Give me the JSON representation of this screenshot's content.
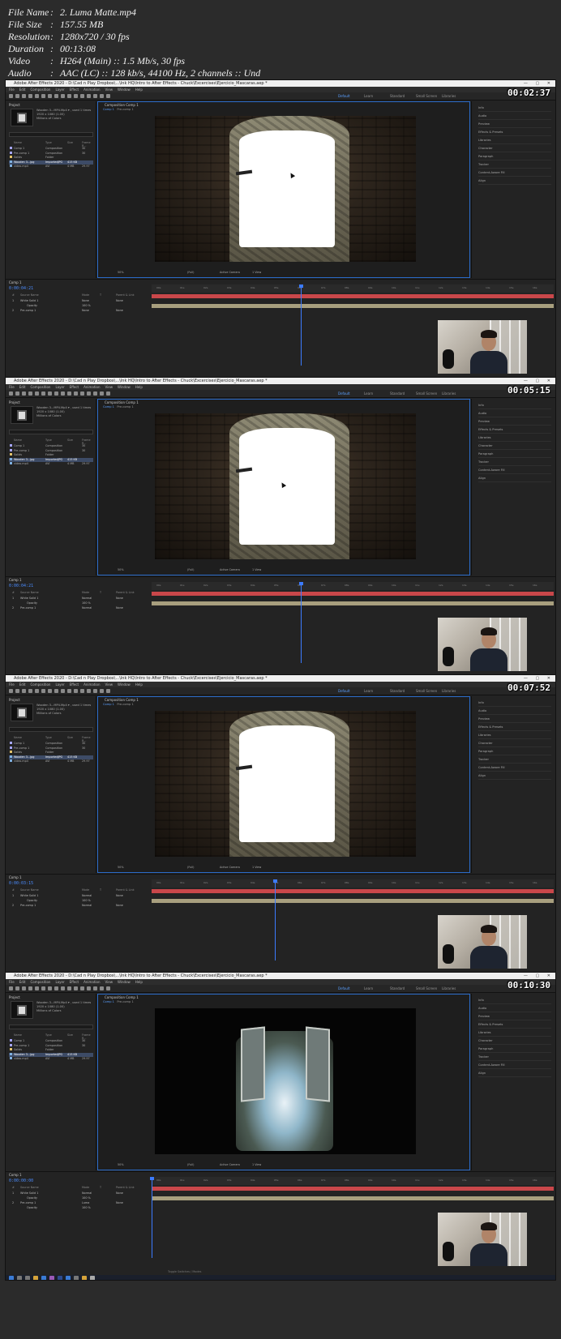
{
  "file_info": [
    {
      "key": "File Name",
      "value": "2. Luma Matte.mp4"
    },
    {
      "key": "File Size",
      "value": "157.55 MB"
    },
    {
      "key": "Resolution",
      "value": "1280x720 / 30 fps"
    },
    {
      "key": "Duration",
      "value": "00:13:08"
    },
    {
      "key": "Video",
      "value": "H264 (Main) :: 1.5 Mb/s, 30 fps"
    },
    {
      "key": "Audio",
      "value": "AAC (LC) :: 128 kb/s, 44100 Hz, 2 channels :: Und"
    }
  ],
  "separator": ":",
  "app": {
    "title": "Adobe After Effects 2020 - D:\\Cad n Play Dropbox\\...\\Ink HQ\\Intro to After Effects - Chuck\\Excercises\\Ejercicio_Mascaras.aep *",
    "window_controls": "— ▢ ✕",
    "menu": [
      "File",
      "Edit",
      "Composition",
      "Layer",
      "Effect",
      "Animation",
      "View",
      "Window",
      "Help"
    ],
    "workspaces": [
      "Default",
      "Learn",
      "Standard",
      "Small Screen",
      "Libraries"
    ],
    "project_label": "Project",
    "comp_tab": "Composition  Comp 1",
    "comp_breadcrumb": "Comp 1",
    "precomp_label": "Pre-comp 1",
    "project_info": [
      "Wooden 3...MP4.Mp4 ▾ , used 1 times",
      "1920 x 1080 (1.00)",
      "Millions of Colors"
    ],
    "project_columns": [
      "Name",
      "Type",
      "Size",
      "Frame R..."
    ],
    "project_items": [
      {
        "name": "Comp 1",
        "type": "Composition",
        "size": "",
        "rate": "30",
        "color": "#a6a6ff"
      },
      {
        "name": "Pre-comp 1",
        "type": "Composition",
        "size": "",
        "rate": "30",
        "color": "#a6a6ff"
      },
      {
        "name": "Solids",
        "type": "Folder",
        "size": "",
        "rate": "",
        "color": "#e3c36b"
      },
      {
        "name": "Wooden 3...jpg",
        "type": "ImportedJPG",
        "size": "415 KB",
        "rate": "",
        "color": "#7fb0e0"
      },
      {
        "name": "video.mp4",
        "type": "AVI",
        "size": "4 MB",
        "rate": "29.97",
        "color": "#7fb0e0"
      }
    ],
    "right_panel": [
      "Info",
      "Audio",
      "Preview",
      "Effects & Presets",
      "Libraries",
      "Character",
      "Paragraph",
      "Tracker",
      "Content-Aware Fill",
      "Align"
    ],
    "timeline_tab": "Comp 1",
    "layer_columns": [
      "#",
      "Source Name",
      "Mode",
      "T",
      "Parent & Link"
    ],
    "footer_label": "Toggle Switches / Modes",
    "camera": "Active Camera",
    "view": "1 View",
    "zoom": "(Full)",
    "magnification": "50%"
  },
  "frames": [
    {
      "timecode": "00:02:37",
      "current_time": "0:00:04:21",
      "viewer": "matte",
      "cursor": true,
      "layers": [
        {
          "num": "1",
          "name": "White Solid 1",
          "mode": "None",
          "parent": "None"
        },
        {
          "num": "",
          "name": "Opacity",
          "mode": "100 %",
          "parent": ""
        },
        {
          "num": "2",
          "name": "Pre-comp 1",
          "mode": "None",
          "parent": "None"
        }
      ]
    },
    {
      "timecode": "00:05:15",
      "current_time": "0:00:04:21",
      "viewer": "matte",
      "cursor": true,
      "layers": [
        {
          "num": "1",
          "name": "White Solid 1",
          "mode": "Normal",
          "parent": "None"
        },
        {
          "num": "",
          "name": "Opacity",
          "mode": "100 %",
          "parent": ""
        },
        {
          "num": "2",
          "name": "Pre-comp 1",
          "mode": "Normal",
          "parent": "None"
        }
      ]
    },
    {
      "timecode": "00:07:52",
      "current_time": "0:00:03:15",
      "viewer": "matte",
      "cursor": false,
      "layers": [
        {
          "num": "1",
          "name": "White Solid 1",
          "mode": "Normal",
          "parent": "None"
        },
        {
          "num": "",
          "name": "Opacity",
          "mode": "100 %",
          "parent": ""
        },
        {
          "num": "2",
          "name": "Pre-comp 1",
          "mode": "Normal",
          "parent": "None"
        }
      ]
    },
    {
      "timecode": "00:10:30",
      "current_time": "0:00:00:00",
      "viewer": "composite",
      "cursor": false,
      "layers": [
        {
          "num": "1",
          "name": "White Solid 1",
          "mode": "Normal",
          "parent": "None"
        },
        {
          "num": "",
          "name": "Opacity",
          "mode": "100 %",
          "parent": ""
        },
        {
          "num": "2",
          "name": "Pre-comp 1",
          "mode": "Luma",
          "parent": "None"
        },
        {
          "num": "",
          "name": "Opacity",
          "mode": "100 %",
          "parent": ""
        }
      ]
    }
  ],
  "ruler_ticks": [
    "00s",
    "01s",
    "02s",
    "03s",
    "04s",
    "05s",
    "06s",
    "07s",
    "08s",
    "09s",
    "10s",
    "11s",
    "12s",
    "13s",
    "14s",
    "15s",
    "16s"
  ],
  "colors": {
    "accent": "#3c7bff",
    "layer_red": "#c9474a",
    "layer_tan": "#a89f7e",
    "selection": "#3d4b66"
  }
}
